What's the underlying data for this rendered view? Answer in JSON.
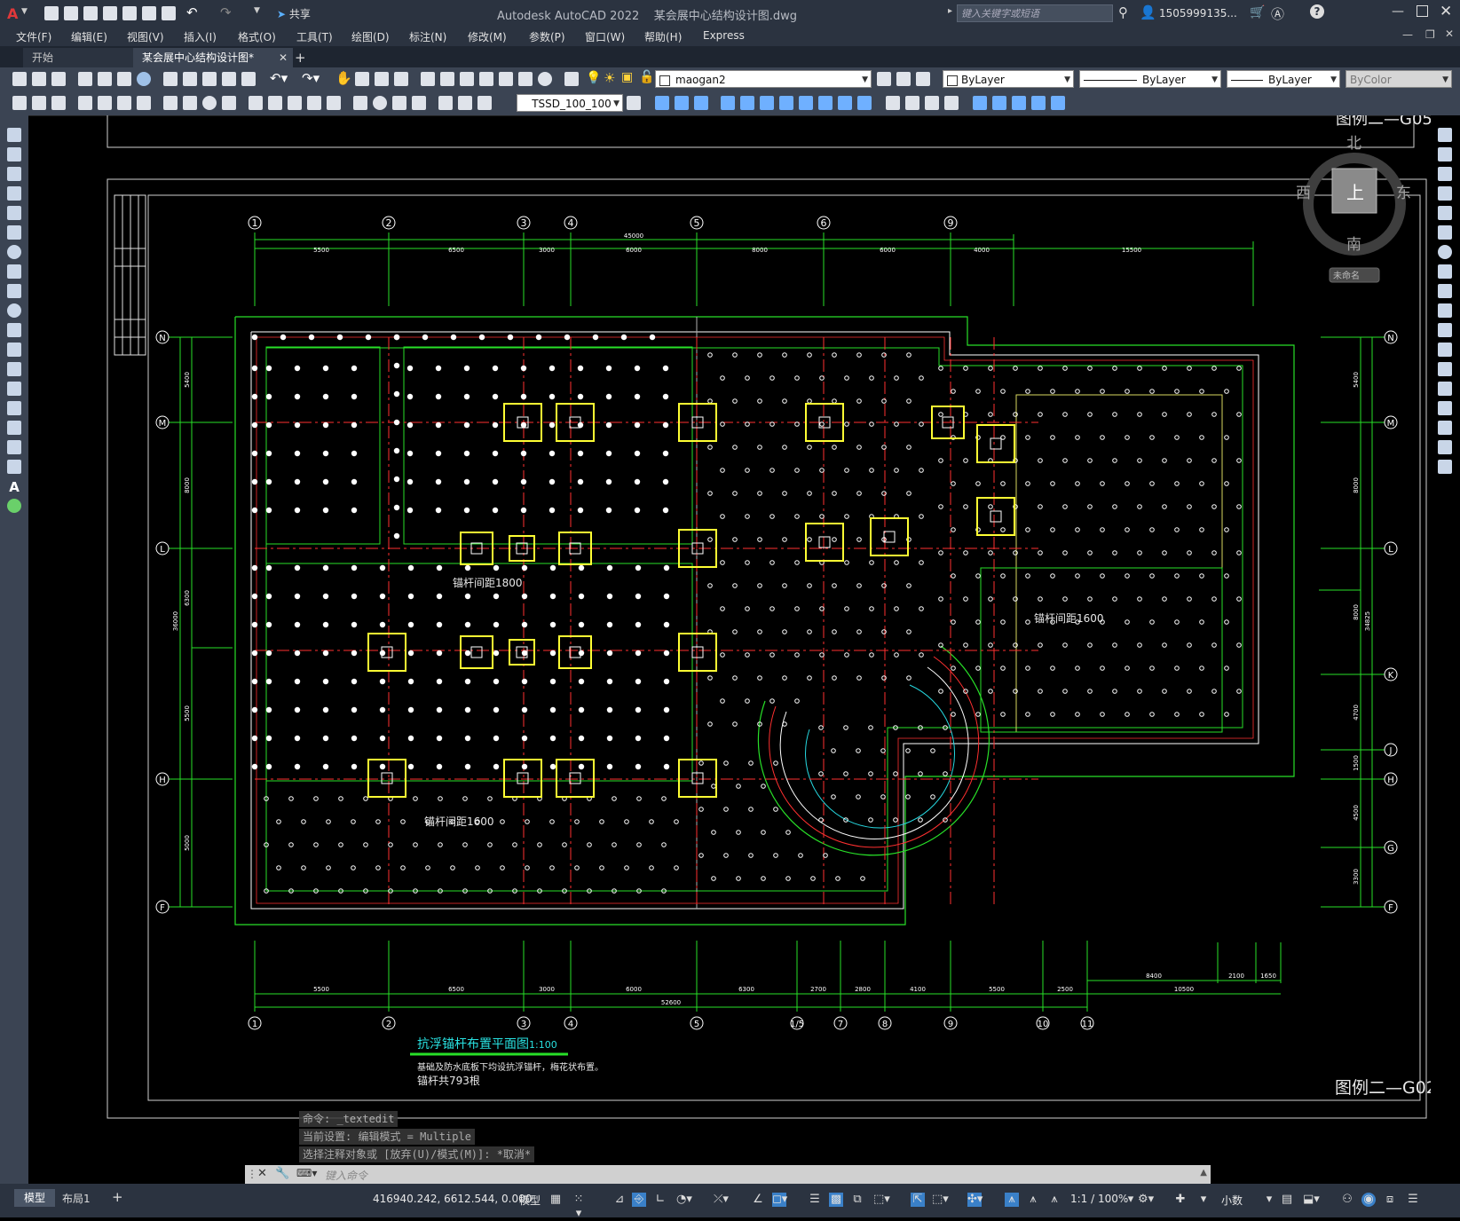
{
  "app": {
    "title": "Autodesk AutoCAD 2022",
    "document": "某会展中心结构设计图.dwg",
    "share_label": "共享",
    "search_placeholder": "键入关键字或短语",
    "user": "1505999135..."
  },
  "menus": [
    "文件(F)",
    "编辑(E)",
    "视图(V)",
    "插入(I)",
    "格式(O)",
    "工具(T)",
    "绘图(D)",
    "标注(N)",
    "修改(M)",
    "参数(P)",
    "窗口(W)",
    "帮助(H)",
    "Express"
  ],
  "tabs": {
    "start": "开始",
    "drawing": "某会展中心结构设计图*",
    "add": "+"
  },
  "layers": {
    "current": "maogan2",
    "color": "ByLayer",
    "linetype": "ByLayer",
    "lineweight": "ByLayer",
    "plotstyle": "ByColor",
    "dimstyle": "TSSD_100_100"
  },
  "viewcube": {
    "north": "北",
    "south": "南",
    "east": "东",
    "west": "西",
    "top": "上",
    "ucs": "未命名"
  },
  "drawing": {
    "grid_top": [
      "1",
      "2",
      "3",
      "4",
      "5",
      "6",
      "9"
    ],
    "grid_bottom": [
      "1",
      "2",
      "3",
      "4",
      "5",
      "1/5",
      "7",
      "8",
      "9",
      "10",
      "11"
    ],
    "grid_left": [
      "N",
      "M",
      "L",
      "H",
      "F"
    ],
    "grid_right": [
      "N",
      "M",
      "L",
      "K",
      "J",
      "H",
      "G",
      "F"
    ],
    "dim_top": [
      "5500",
      "6500",
      "3000",
      "6000",
      "8000",
      "6000",
      "4000",
      "15500"
    ],
    "dim_top_total": "45000",
    "dim_bottom": [
      "5500",
      "6500",
      "3000",
      "6000",
      "6300",
      "2700",
      "2800",
      "4100",
      "5500",
      "2500"
    ],
    "dim_bottom_total": "52600",
    "dim_bottom_right": [
      "8400",
      "2100",
      "1650",
      "10500"
    ],
    "dim_left": [
      "5400",
      "8000",
      "6300",
      "5500",
      "5000"
    ],
    "dim_left_total": "36000",
    "dim_right": [
      "5400",
      "8000",
      "8000",
      "4700",
      "1500",
      "4500",
      "3300"
    ],
    "dim_right_total": "34825",
    "label_1800": "锚杆间距1800",
    "label_1600a": "锚杆间距1600",
    "label_1600b": "锚杆间距1600",
    "plan_title": "抗浮锚杆布置平面图",
    "plan_scale": "1:100",
    "note1": "基础及防水底板下均设抗浮锚杆，梅花状布置。",
    "note2": "锚杆共793根",
    "legend": "图例二—G02",
    "legend_top": "图例二—G05"
  },
  "command": {
    "line1": "命令: _textedit",
    "line2": "当前设置: 编辑模式 = Multiple",
    "line3": "选择注释对象或 [放弃(U)/模式(M)]: *取消*",
    "placeholder": "键入命令"
  },
  "layout_tabs": {
    "model": "模型",
    "layout1": "布局1",
    "add": "+"
  },
  "status": {
    "coords": "416940.242, 6612.544, 0.000",
    "model": "模型",
    "scale": "1:1 / 100%",
    "units": "小数"
  }
}
